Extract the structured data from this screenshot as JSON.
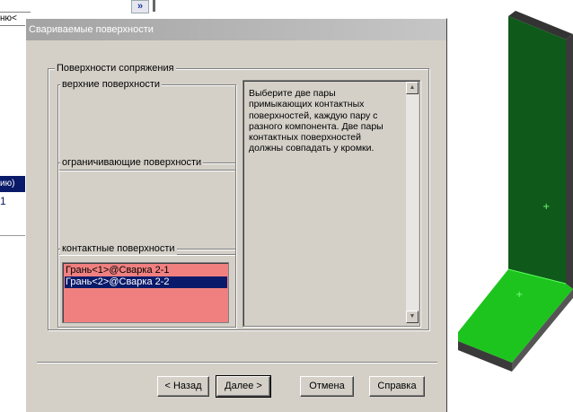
{
  "background": {
    "tab_text": "ню<",
    "top_button": "»",
    "selected_text": "ию)",
    "selected_text2": "1"
  },
  "dialog": {
    "title": "Свариваемые поверхности",
    "mating_group_label": "Поверхности сопряжения",
    "top_faces_label": "верхние поверхности",
    "bounding_faces_label": "ограничивающие поверхности",
    "contact_faces_label": "контактные поверхности",
    "contact_faces": [
      "Грань<1>@Сварка 2-1",
      "Грань<2>@Сварка 2-2"
    ],
    "selected_index": 1,
    "hint": "Выберите две пары примыкающих контактных поверхностей, каждую пару с разного компонента.  Две пары контактных поверхностей должны совпадать у кромки.",
    "buttons": {
      "back": "< Назад",
      "next": "Далее >",
      "cancel": "Отмена",
      "help": "Справка"
    }
  },
  "colors": {
    "model_face": "#1ec41e",
    "model_face_dark": "#0f5a1a",
    "list_bg": "#f08080",
    "selection": "#0a1a6a"
  }
}
